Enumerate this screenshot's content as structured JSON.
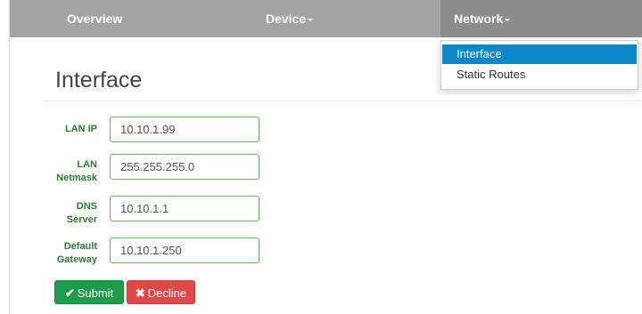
{
  "navbar": {
    "items": [
      {
        "label": "Overview"
      },
      {
        "label": "Device"
      },
      {
        "label": "Network"
      }
    ]
  },
  "dropdown": {
    "items": [
      {
        "label": "Interface",
        "active": true
      },
      {
        "label": "Static Routes",
        "active": false
      }
    ]
  },
  "page": {
    "title": "Interface"
  },
  "form": {
    "fields": [
      {
        "label_line1": "LAN IP",
        "label_line2": "",
        "value": "10.10.1.99"
      },
      {
        "label_line1": "LAN",
        "label_line2": "Netmask",
        "value": "255.255.255.0"
      },
      {
        "label_line1": "DNS",
        "label_line2": "Server",
        "value": "10.10.1.1"
      },
      {
        "label_line1": "Default",
        "label_line2": "Gateway",
        "value": "10.10.1.250"
      }
    ]
  },
  "buttons": {
    "submit_label": "Submit",
    "submit_icon": "check-icon",
    "decline_label": "Decline",
    "decline_icon": "x-icon"
  },
  "colors": {
    "navbar": "#a3a3a3",
    "navbar_active": "#8c8c8c",
    "dropdown_active": "#0a87c8",
    "label_green": "#2e7d32",
    "input_border": "#5cb85c",
    "submit": "#1e9c4a",
    "decline": "#e04848"
  }
}
